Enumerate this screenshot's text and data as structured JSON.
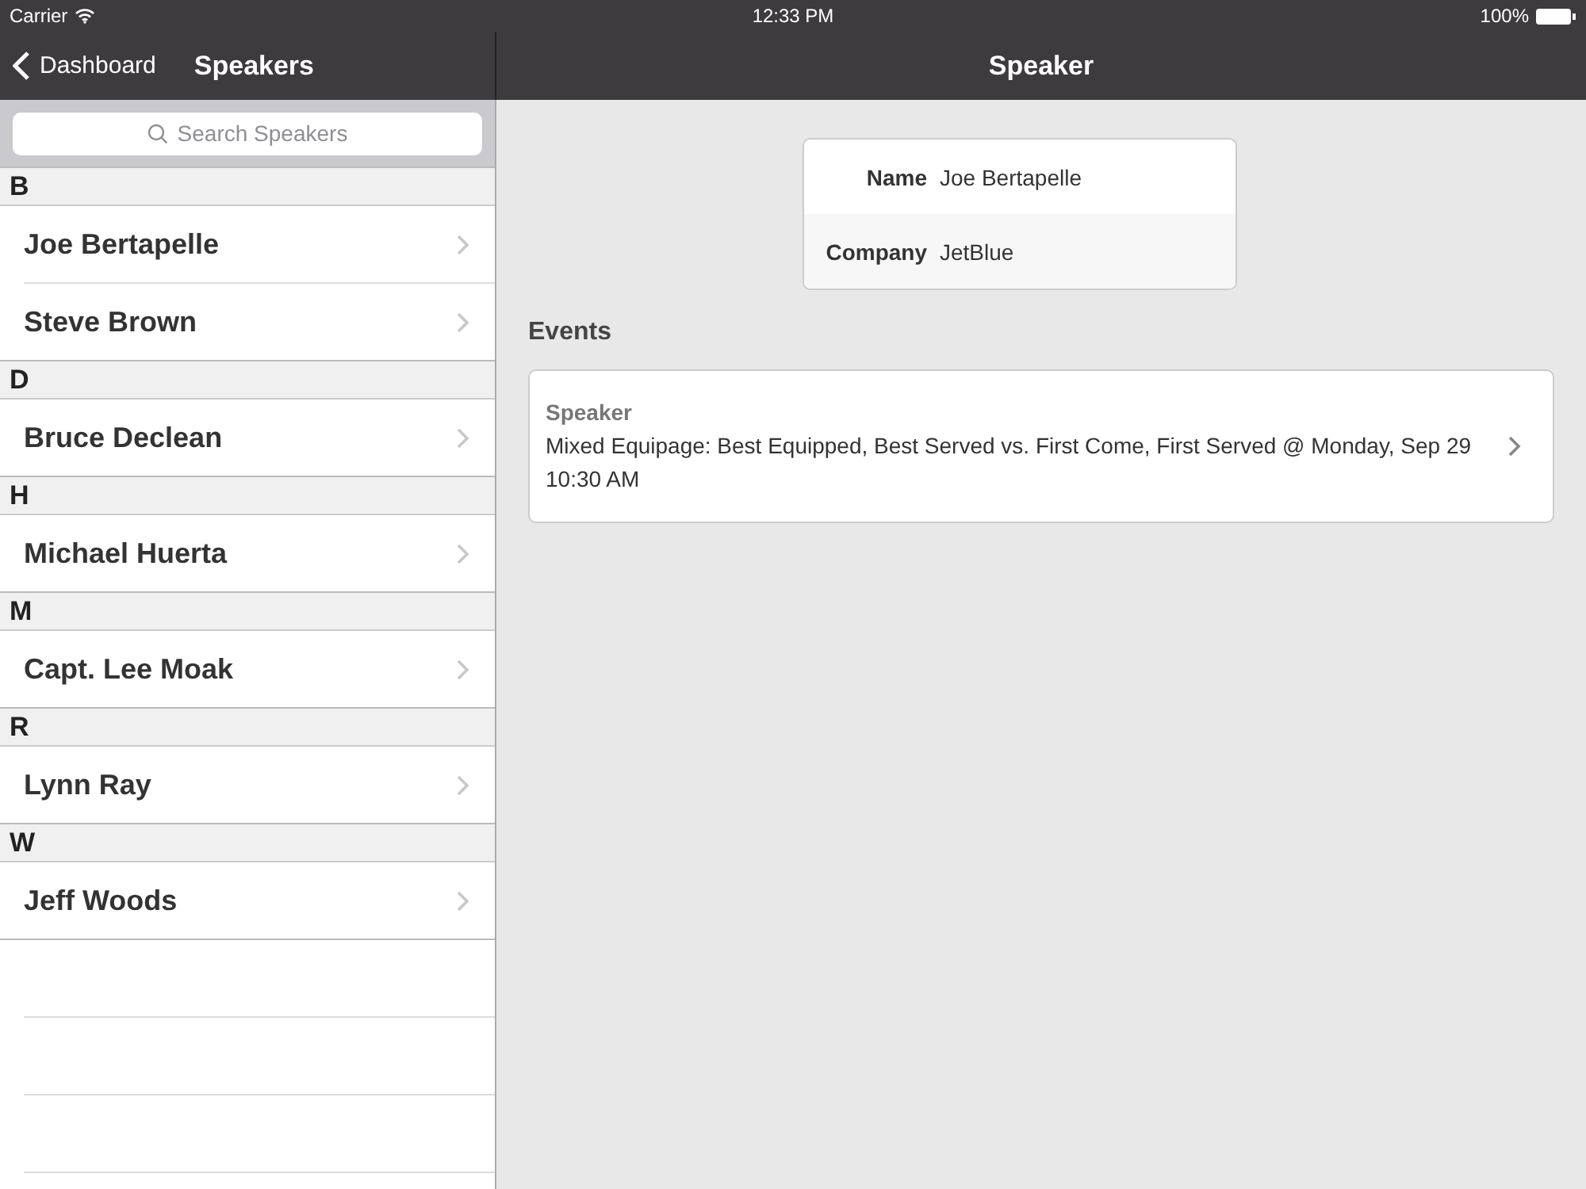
{
  "status_bar": {
    "carrier": "Carrier",
    "time": "12:33 PM",
    "battery": "100%"
  },
  "master": {
    "back_label": "Dashboard",
    "title": "Speakers",
    "search": {
      "placeholder": "Search Speakers"
    },
    "sections": [
      {
        "letter": "B",
        "items": [
          "Joe Bertapelle",
          "Steve Brown"
        ]
      },
      {
        "letter": "D",
        "items": [
          "Bruce Declean"
        ]
      },
      {
        "letter": "H",
        "items": [
          "Michael Huerta"
        ]
      },
      {
        "letter": "M",
        "items": [
          "Capt. Lee Moak"
        ]
      },
      {
        "letter": "R",
        "items": [
          "Lynn Ray"
        ]
      },
      {
        "letter": "W",
        "items": [
          "Jeff Woods"
        ]
      }
    ]
  },
  "detail": {
    "title": "Speaker",
    "fields": [
      {
        "label": "Name",
        "value": "Joe Bertapelle"
      },
      {
        "label": "Company",
        "value": "JetBlue"
      }
    ],
    "events_heading": "Events",
    "events": [
      {
        "role": "Speaker",
        "text": "Mixed Equipage: Best Equipped, Best Served vs. First Come, First Served @ Monday, Sep 29 10:30 AM"
      }
    ]
  }
}
